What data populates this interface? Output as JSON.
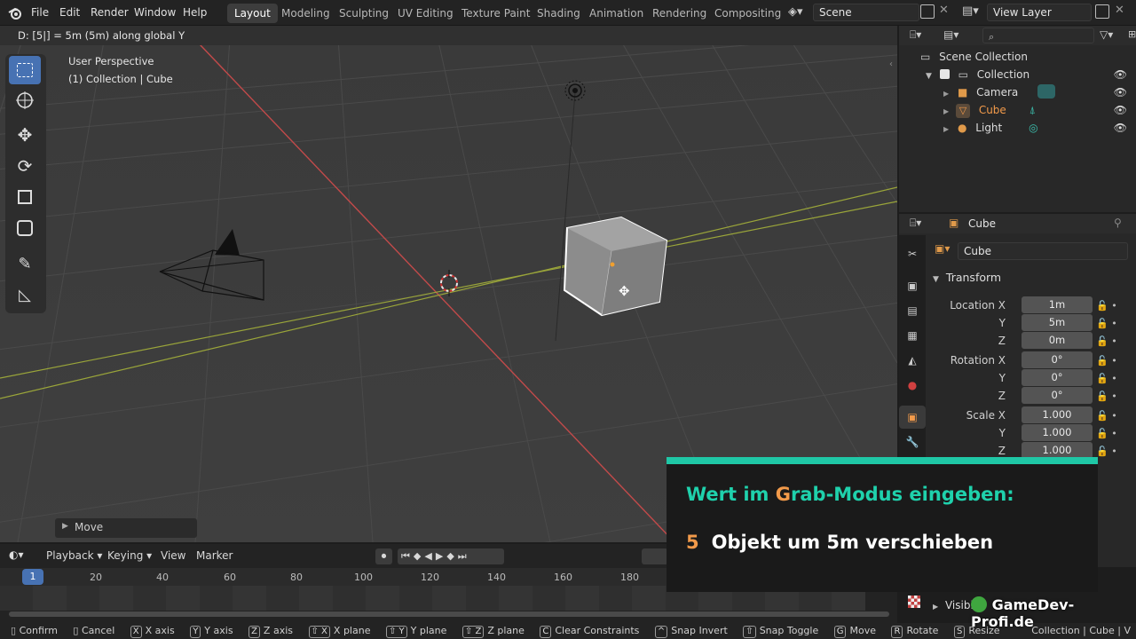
{
  "topbar": {
    "menus": [
      "File",
      "Edit",
      "Render",
      "Window",
      "Help"
    ],
    "workspaces": [
      "Layout",
      "Modeling",
      "Sculpting",
      "UV Editing",
      "Texture Paint",
      "Shading",
      "Animation",
      "Rendering",
      "Compositing"
    ],
    "active_workspace": "Layout",
    "scene": "Scene",
    "view_layer": "View Layer"
  },
  "viewport": {
    "header_info": "D: [5|] = 5m (5m) along global Y",
    "perspective": "User Perspective",
    "collection_info": "(1) Collection | Cube",
    "last_op": "Move",
    "colors": {
      "x_axis": "#c24a4a",
      "y_axis": "#9aa53a",
      "selected_outline": "#ffffff"
    }
  },
  "outliner": {
    "root": "Scene Collection",
    "collection": "Collection",
    "items": [
      {
        "name": "Camera",
        "icon": "camera-icon"
      },
      {
        "name": "Cube",
        "icon": "mesh-icon",
        "active": true
      },
      {
        "name": "Light",
        "icon": "light-icon"
      }
    ]
  },
  "properties": {
    "object_name": "Cube",
    "data_name": "Cube",
    "panel": "Transform",
    "location": {
      "label": "Location X",
      "x": "1m",
      "y": "5m",
      "z": "0m"
    },
    "rotation": {
      "label": "Rotation X",
      "x": "0°",
      "y": "0°",
      "z": "0°"
    },
    "scale": {
      "label": "Scale X",
      "x": "1.000",
      "y": "1.000",
      "z": "1.000"
    },
    "axis_y": "Y",
    "axis_z": "Z",
    "visibility_label": "Visibili"
  },
  "timeline": {
    "menus": [
      "Playback",
      "Keying",
      "View",
      "Marker"
    ],
    "current_frame": "1",
    "ticks": [
      "20",
      "40",
      "60",
      "80",
      "100",
      "120",
      "140",
      "160",
      "180"
    ]
  },
  "statusbar": {
    "items": [
      {
        "key": "",
        "label": "Confirm"
      },
      {
        "key": "",
        "label": "Cancel"
      },
      {
        "key": "X",
        "label": "X axis"
      },
      {
        "key": "Y",
        "label": "Y axis"
      },
      {
        "key": "Z",
        "label": "Z axis"
      },
      {
        "key": "⇧ X",
        "label": "X plane"
      },
      {
        "key": "⇧ Y",
        "label": "Y plane"
      },
      {
        "key": "⇧ Z",
        "label": "Z plane"
      },
      {
        "key": "C",
        "label": "Clear Constraints"
      },
      {
        "key": "^",
        "label": "Snap Invert"
      },
      {
        "key": "⇧",
        "label": "Snap Toggle"
      },
      {
        "key": "G",
        "label": "Move"
      },
      {
        "key": "R",
        "label": "Rotate"
      },
      {
        "key": "S",
        "label": "Resize"
      }
    ],
    "right_info": "Collection | Cube | V"
  },
  "overlay": {
    "title_a": "Wert im ",
    "title_g": "G",
    "title_b": "rab-Modus eingeben:",
    "step_num": "5",
    "step_text": "Objekt um 5m verschieben",
    "accent": "#1fc7a6",
    "watermark": "GameDev-Profi.de"
  }
}
